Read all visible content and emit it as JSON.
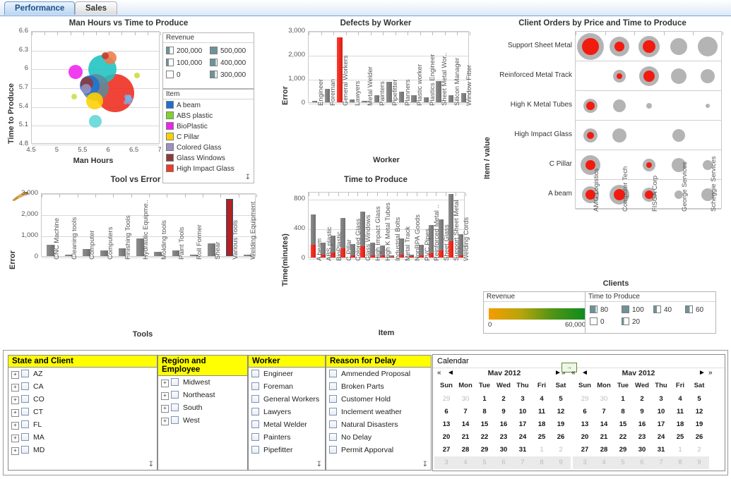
{
  "tabs": [
    {
      "label": "Performance",
      "active": true
    },
    {
      "label": "Sales",
      "active": false
    }
  ],
  "charts": {
    "bubble": {
      "title": "Man Hours vs Time to Produce",
      "xlabel": "Man Hours",
      "ylabel": "Time to Produce",
      "xticks": [
        "4.5",
        "5",
        "5.5",
        "6",
        "6.5",
        "7"
      ],
      "yticks": [
        "6.6",
        "6.3",
        "6",
        "5.7",
        "5.4",
        "5.1",
        "4.8"
      ],
      "xlim": [
        4.5,
        7
      ],
      "ylim": [
        4.8,
        6.6
      ],
      "revenue_legend": {
        "title": "Revenue",
        "entries": [
          "200,000",
          "500,000",
          "100,000",
          "400,000",
          "0",
          "300,000"
        ]
      },
      "item_legend": {
        "title": "Item",
        "entries": [
          {
            "label": "A beam",
            "color": "#1f6fd0"
          },
          {
            "label": "ABS plastic",
            "color": "#7fd42a"
          },
          {
            "label": "BioPlastic",
            "color": "#ee22ee"
          },
          {
            "label": "C Pillar",
            "color": "#ffd000"
          },
          {
            "label": "Colored Glass",
            "color": "#9b8fc4"
          },
          {
            "label": "Glass Windows",
            "color": "#8c3a3a"
          },
          {
            "label": "High Impact Glass",
            "color": "#ee3b2a"
          }
        ]
      },
      "points": [
        {
          "item": "High Impact Glass",
          "x": 6.12,
          "y": 5.62,
          "r": 27,
          "color": "#ee2a1c"
        },
        {
          "item": "Teal Large",
          "x": 5.87,
          "y": 6.0,
          "r": 20,
          "color": "#1ec2c2"
        },
        {
          "item": "Slate",
          "x": 5.73,
          "y": 5.71,
          "r": 19,
          "color": "#5d8a99"
        },
        {
          "item": "A beam",
          "x": 5.62,
          "y": 5.74,
          "r": 14,
          "color": "#1f6fd0"
        },
        {
          "item": "C Pillar",
          "x": 5.72,
          "y": 5.5,
          "r": 12,
          "color": "#ffd000"
        },
        {
          "item": "BioPlastic",
          "x": 5.35,
          "y": 5.96,
          "r": 10,
          "color": "#ee22ee"
        },
        {
          "item": "Glass Windows",
          "x": 5.57,
          "y": 5.78,
          "r": 9,
          "color": "#8c3a3a"
        },
        {
          "item": "Colored Glass",
          "x": 5.56,
          "y": 5.69,
          "r": 7,
          "color": "#9b8fc4"
        },
        {
          "item": "Cyan Small",
          "x": 5.73,
          "y": 5.17,
          "r": 9,
          "color": "#5fd6d6"
        },
        {
          "item": "Orange",
          "x": 6.03,
          "y": 6.18,
          "r": 9,
          "color": "#f0794a"
        },
        {
          "item": "Dark Red Dot",
          "x": 5.93,
          "y": 6.22,
          "r": 5,
          "color": "#c0392b"
        },
        {
          "item": "ABS plastic",
          "x": 6.55,
          "y": 5.9,
          "r": 4,
          "color": "#c8dd3a"
        },
        {
          "item": "Yellow Small",
          "x": 5.32,
          "y": 5.57,
          "r": 4,
          "color": "#cddd4a"
        },
        {
          "item": "Blue Cluster",
          "x": 6.38,
          "y": 5.54,
          "r": 4,
          "color": "#6ea8e8"
        }
      ]
    },
    "defects": {
      "type": "bar",
      "title": "Defects by Worker",
      "xlabel": "Worker",
      "ylabel": "Error",
      "yticks": [
        "3,000",
        "2,000",
        "1,000",
        "0"
      ],
      "ylim": [
        0,
        3000
      ],
      "highlight": "General Workers",
      "categories": [
        "Engineer",
        "Foreman",
        "General Workers",
        "Lawyers",
        "Metal Welder",
        "Painters",
        "Pipefitter",
        "Planners",
        "Plastic worker",
        "Plastics Engineer",
        "Sheet Metal Wor..",
        "Silicon Manager",
        "Window Fitter"
      ],
      "values": [
        70,
        560,
        2700,
        120,
        60,
        290,
        840,
        430,
        290,
        210,
        880,
        290,
        380
      ]
    },
    "tool": {
      "type": "bar",
      "title": "Tool vs Error",
      "xlabel": "Tools",
      "ylabel": "Error",
      "yticks": [
        "3,000",
        "2,000",
        "1,000",
        "0"
      ],
      "ylim": [
        0,
        3000
      ],
      "highlight": "Various Tools",
      "categories": [
        "CNC Machine",
        "Cleaning tools",
        "Computer",
        "Computers",
        "Finishing Tools",
        "Hydraulic Equipme..",
        "Molding tools",
        "Paint Tools",
        "Roll Former",
        "Shear",
        "Various Tools",
        "Welding Equipment"
      ],
      "values": [
        540,
        70,
        320,
        280,
        370,
        850,
        200,
        280,
        70,
        600,
        2700,
        45
      ],
      "first_bar_value": 540
    },
    "time_to_produce": {
      "type": "bar",
      "title": "Time to Produce",
      "xlabel": "Item",
      "ylabel": "Time(minutes)",
      "yticks": [
        "800",
        "400",
        "0"
      ],
      "ylim": [
        0,
        900
      ],
      "categories": [
        "A beam",
        "ABS plastic",
        "BioPlastic",
        "C Pillar",
        "Colored Glass",
        "Glass Windows",
        "High Impact Glass",
        "High K Metal Tubes",
        "Industrial Bolts",
        "Metal Track",
        "NonBPA Goods",
        "PVC Pipes",
        "Reinforced Metal ..",
        "Sheet Glass",
        "Support Sheet Metal",
        "Welding Cords"
      ],
      "series": [
        {
          "name": "Red",
          "values": [
            175,
            40,
            65,
            125,
            25,
            150,
            25,
            25,
            10,
            40,
            18,
            25,
            55,
            100,
            225,
            30
          ]
        },
        {
          "name": "Gray",
          "values": [
            405,
            160,
            230,
            415,
            155,
            470,
            180,
            135,
            22,
            215,
            22,
            150,
            385,
            415,
            635,
            290
          ]
        }
      ]
    },
    "matrix": {
      "title": "Client Orders by Price and Time to Produce",
      "ylabel": "Item / value",
      "xlabel": "Clients",
      "rows": [
        "Support Sheet Metal",
        "Reinforced Metal Track",
        "High K Metal Tubes",
        "High Impact Glass",
        "C Pillar",
        "A beam"
      ],
      "columns": [
        "AMG Logistics",
        "Computer Tech",
        "FISGA Corp",
        "George Services",
        "Scheggie Services"
      ],
      "cells": [
        [
          {
            "outer": 19,
            "inner": 12
          },
          {
            "outer": 14,
            "inner": 7
          },
          {
            "outer": 15,
            "inner": 9
          },
          {
            "outer": 12,
            "inner": 0
          },
          {
            "outer": 14,
            "inner": 0
          }
        ],
        [
          null,
          {
            "outer": 9,
            "inner": 4
          },
          {
            "outer": 14,
            "inner": 8
          },
          {
            "outer": 11,
            "inner": 0
          },
          {
            "outer": 10,
            "inner": 0
          }
        ],
        [
          {
            "outer": 10,
            "inner": 6
          },
          {
            "outer": 9,
            "inner": 0
          },
          {
            "outer": 4,
            "inner": 0
          },
          null,
          {
            "outer": 3,
            "inner": 0
          }
        ],
        [
          {
            "outer": 10,
            "inner": 5
          },
          {
            "outer": 10,
            "inner": 0
          },
          null,
          {
            "outer": 9,
            "inner": 0
          },
          null
        ],
        [
          {
            "outer": 14,
            "inner": 7
          },
          null,
          {
            "outer": 9,
            "inner": 4
          },
          {
            "outer": 10,
            "inner": 0
          },
          {
            "outer": 7,
            "inner": 0
          }
        ],
        [
          {
            "outer": 12,
            "inner": 7
          },
          {
            "outer": 14,
            "inner": 8
          },
          {
            "outer": 10,
            "inner": 6
          },
          {
            "outer": 6,
            "inner": 0
          },
          {
            "outer": 9,
            "inner": 0
          }
        ]
      ],
      "revenue_legend": {
        "title": "Revenue",
        "min": "0",
        "max": "60,000",
        "gradient_from": "#f59c00",
        "gradient_to": "#0e8c1e"
      },
      "time_legend": {
        "title": "Time to Produce",
        "entries": [
          "80",
          "100",
          "40",
          "60",
          "0",
          "20"
        ]
      }
    }
  },
  "filters": {
    "columns": [
      {
        "header": "State and Client",
        "expandable": true,
        "items": [
          "AZ",
          "CA",
          "CO",
          "CT",
          "FL",
          "MA",
          "MD"
        ]
      },
      {
        "header": "Region and Employee",
        "expandable": true,
        "items": [
          "Midwest",
          "Northeast",
          "South",
          "West"
        ]
      },
      {
        "header": "Worker",
        "expandable": false,
        "items": [
          "Engineer",
          "Foreman",
          "General Workers",
          "Lawyers",
          "Metal Welder",
          "Painters",
          "Pipefitter"
        ]
      },
      {
        "header": "Reason for Delay",
        "expandable": false,
        "items": [
          "Ammended Proposal",
          "Broken Parts",
          "Customer Hold",
          "Inclement weather",
          "Natural Disasters",
          "No Delay",
          "Permit Apporval"
        ]
      }
    ]
  },
  "calendar": {
    "title": "Calendar",
    "dow": [
      "Sun",
      "Mon",
      "Tue",
      "Wed",
      "Thu",
      "Fri",
      "Sat"
    ],
    "months": [
      {
        "label": "Mav 2012",
        "weeks": [
          [
            {
              "d": "29",
              "out": true
            },
            {
              "d": "30",
              "out": true
            },
            {
              "d": "1"
            },
            {
              "d": "2"
            },
            {
              "d": "3"
            },
            {
              "d": "4"
            },
            {
              "d": "5"
            }
          ],
          [
            {
              "d": "6"
            },
            {
              "d": "7"
            },
            {
              "d": "8"
            },
            {
              "d": "9"
            },
            {
              "d": "10"
            },
            {
              "d": "11"
            },
            {
              "d": "12"
            }
          ],
          [
            {
              "d": "13"
            },
            {
              "d": "14"
            },
            {
              "d": "15"
            },
            {
              "d": "16"
            },
            {
              "d": "17"
            },
            {
              "d": "18"
            },
            {
              "d": "19"
            }
          ],
          [
            {
              "d": "20"
            },
            {
              "d": "21"
            },
            {
              "d": "22"
            },
            {
              "d": "23"
            },
            {
              "d": "24"
            },
            {
              "d": "25"
            },
            {
              "d": "26"
            }
          ],
          [
            {
              "d": "27"
            },
            {
              "d": "28"
            },
            {
              "d": "29"
            },
            {
              "d": "30"
            },
            {
              "d": "31"
            },
            {
              "d": "1",
              "out": true
            },
            {
              "d": "2",
              "out": true
            }
          ],
          [
            {
              "d": "3",
              "out": true
            },
            {
              "d": "4",
              "out": true
            },
            {
              "d": "5",
              "out": true
            },
            {
              "d": "6",
              "out": true
            },
            {
              "d": "7",
              "out": true
            },
            {
              "d": "8",
              "out": true
            },
            {
              "d": "9",
              "out": true
            }
          ]
        ]
      },
      {
        "label": "Mav 2012",
        "weeks": [
          [
            {
              "d": "29",
              "out": true
            },
            {
              "d": "30",
              "out": true
            },
            {
              "d": "1"
            },
            {
              "d": "2"
            },
            {
              "d": "3"
            },
            {
              "d": "4"
            },
            {
              "d": "5"
            }
          ],
          [
            {
              "d": "6"
            },
            {
              "d": "7"
            },
            {
              "d": "8"
            },
            {
              "d": "9"
            },
            {
              "d": "10"
            },
            {
              "d": "11"
            },
            {
              "d": "12"
            }
          ],
          [
            {
              "d": "13"
            },
            {
              "d": "14"
            },
            {
              "d": "15"
            },
            {
              "d": "16"
            },
            {
              "d": "17"
            },
            {
              "d": "18"
            },
            {
              "d": "19"
            }
          ],
          [
            {
              "d": "20"
            },
            {
              "d": "21"
            },
            {
              "d": "22"
            },
            {
              "d": "23"
            },
            {
              "d": "24"
            },
            {
              "d": "25"
            },
            {
              "d": "26"
            }
          ],
          [
            {
              "d": "27"
            },
            {
              "d": "28"
            },
            {
              "d": "29"
            },
            {
              "d": "30"
            },
            {
              "d": "31"
            },
            {
              "d": "1",
              "out": true
            },
            {
              "d": "2",
              "out": true
            }
          ],
          [
            {
              "d": "3",
              "out": true
            },
            {
              "d": "4",
              "out": true
            },
            {
              "d": "5",
              "out": true
            },
            {
              "d": "6",
              "out": true
            },
            {
              "d": "7",
              "out": true
            },
            {
              "d": "8",
              "out": true
            },
            {
              "d": "9",
              "out": true
            }
          ]
        ]
      }
    ],
    "nav": {
      "first": "«",
      "prev": "◄",
      "next": "►",
      "last": "»"
    }
  }
}
